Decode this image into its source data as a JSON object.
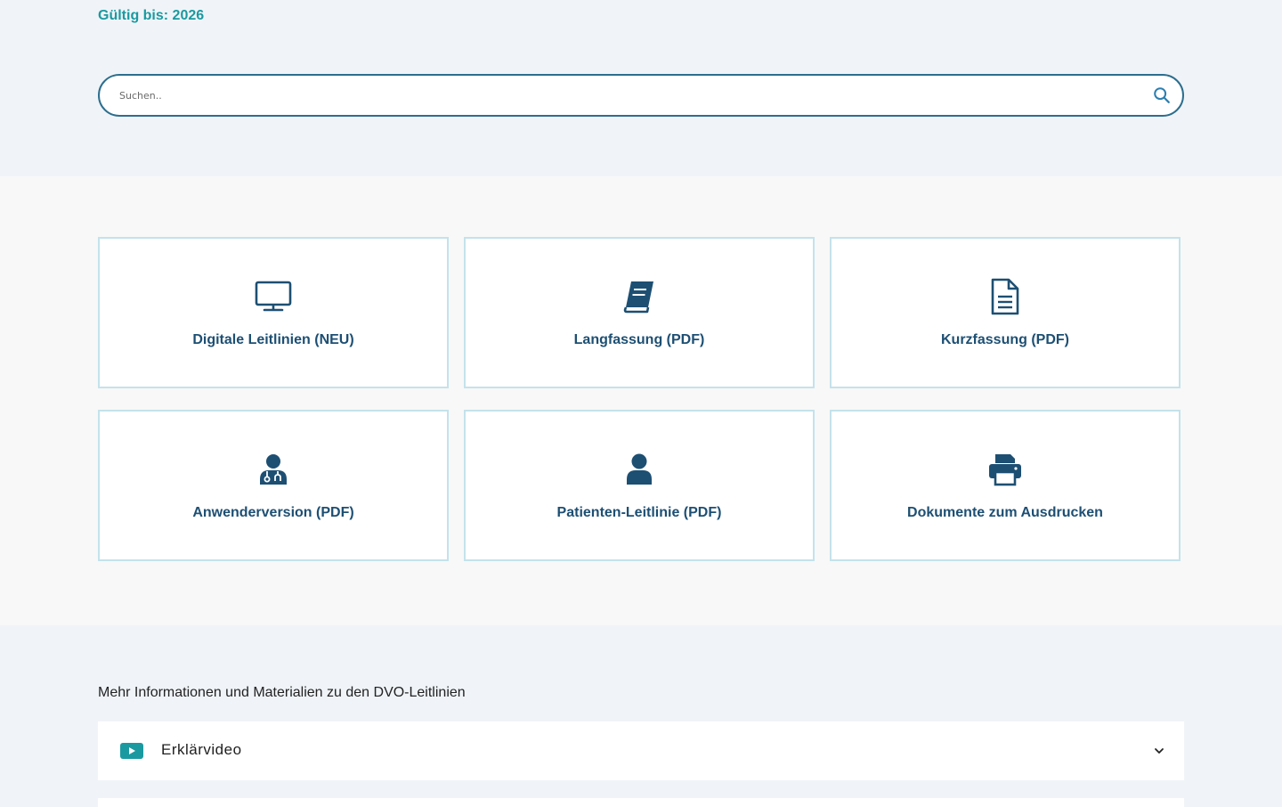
{
  "header": {
    "valid_until": "Gültig bis: 2026"
  },
  "search": {
    "placeholder": "Suchen..",
    "value": ""
  },
  "tiles": [
    {
      "label": "Digitale Leitlinien (NEU)",
      "icon": "monitor-icon"
    },
    {
      "label": "Langfassung (PDF)",
      "icon": "book-icon"
    },
    {
      "label": "Kurzfassung (PDF)",
      "icon": "document-icon"
    },
    {
      "label": "Anwenderversion (PDF)",
      "icon": "doctor-icon"
    },
    {
      "label": "Patienten-Leitlinie (PDF)",
      "icon": "user-icon"
    },
    {
      "label": "Dokumente zum Ausdrucken",
      "icon": "printer-icon"
    }
  ],
  "info": {
    "heading": "Mehr Informationen und Materialien zu den DVO-Leitlinien",
    "accordion": [
      {
        "label": "Erklärvideo",
        "icon": "youtube-icon"
      }
    ]
  },
  "colors": {
    "accent_teal": "#1a9aa0",
    "primary_blue": "#1d4f73",
    "tile_border": "#c4e2ec",
    "search_border": "#2d6e8e"
  }
}
